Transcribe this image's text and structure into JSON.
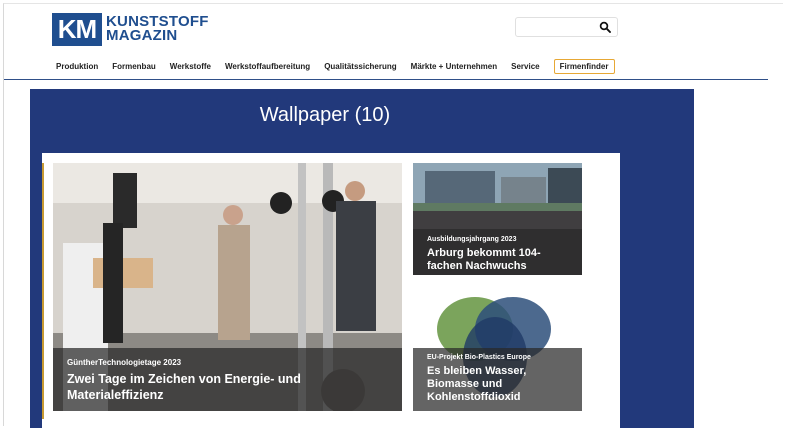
{
  "logo": {
    "mark": "KM",
    "line1": "KUNSTSTOFF",
    "line2": "MAGAZIN"
  },
  "search": {
    "placeholder": "",
    "icon": "search-icon"
  },
  "nav": {
    "items": [
      "Produktion",
      "Formenbau",
      "Werkstoffe",
      "Werkstoffaufbereitung",
      "Qualitätssicherung",
      "Märkte + Unternehmen",
      "Service",
      "Firmenfinder"
    ]
  },
  "banner": {
    "title": "Wallpaper (10)"
  },
  "cards": {
    "main": {
      "kicker": "GüntherTechnologietage 2023",
      "title": "Zwei Tage im Zeichen von Energie- und Materialeffizienz"
    },
    "top": {
      "kicker": "Ausbildungsjahrgang 2023",
      "title": "Arburg bekommt 104-fachen Nachwuchs"
    },
    "bottom": {
      "kicker": "EU-Projekt Bio-Plastics Europe",
      "title": "Es bleiben Wasser, Biomasse und Kohlenstoffdioxid"
    }
  },
  "colors": {
    "brand": "#1f4e8f",
    "banner": "#22397b",
    "accent": "#e7a835"
  }
}
